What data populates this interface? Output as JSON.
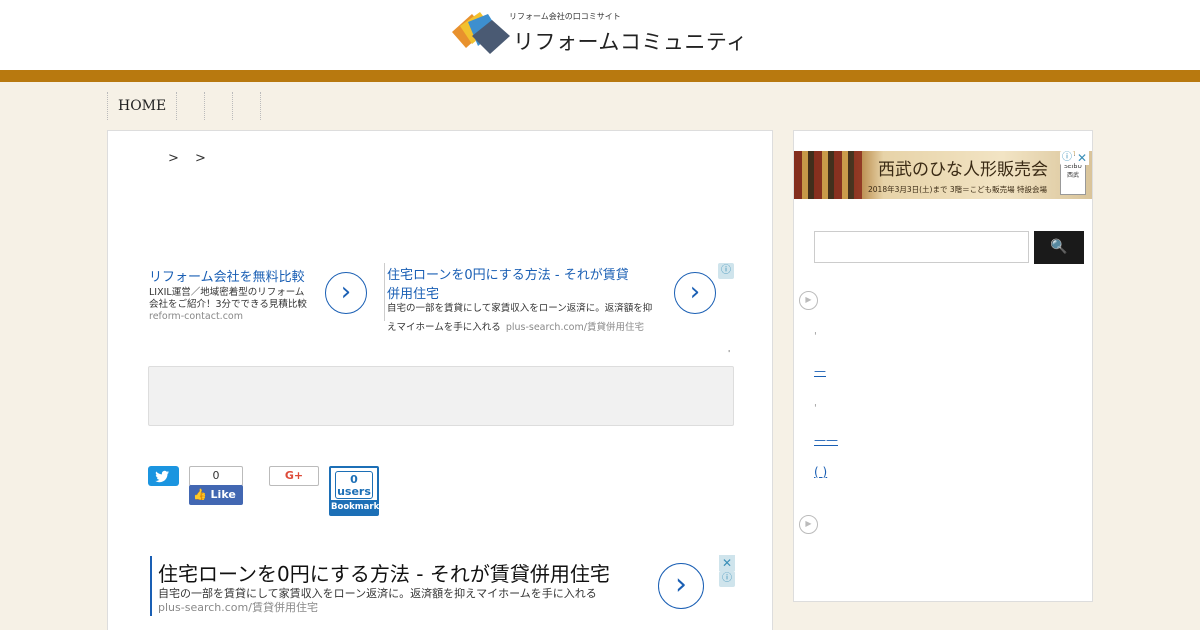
{
  "header": {
    "logo_tagline": "リフォーム会社の口コミサイト",
    "logo_title": "リフォームコミュニティ",
    "logo_colors": [
      "#e8912d",
      "#f2c12e",
      "#3d8fcf",
      "#4a5a73"
    ]
  },
  "colors": {
    "accent_bar": "#b8790f",
    "page_background": "#f6f1e6",
    "ad_link": "#1a5fb4"
  },
  "nav": {
    "items": [
      {
        "label": "HOME"
      },
      {
        "label": ""
      },
      {
        "label": ""
      },
      {
        "label": ""
      }
    ]
  },
  "breadcrumb": {
    "separators": "> >"
  },
  "ad_top": {
    "left": {
      "title": "リフォーム会社を無料比較",
      "desc_line1": "LIXIL運営／地域密着型のリフォーム",
      "desc_line2": "会社をご紹介！3分でできる見積比較",
      "url": "reform-contact.com"
    },
    "right": {
      "title_line1": "住宅ローンを0円にする方法 - それが賃貸",
      "title_line2": "併用住宅",
      "desc_line1": "自宅の一部を賃貸にして家賃収入をローン返済に。返済額を抑",
      "desc_line2": "えマイホームを手に入れる",
      "url": "plus-search.com/賃貸併用住宅"
    },
    "info_icon": "ⓘ"
  },
  "share": {
    "facebook_count": "0",
    "facebook_like": "Like",
    "gplus_label": "G+",
    "hatena_count": "0",
    "hatena_users": "users",
    "hatena_label": "Bookmark"
  },
  "ad_bottom": {
    "title": "住宅ローンを0円にする方法 - それが賃貸併用住宅",
    "desc": "自宅の一部を賃貸にして家賃収入をローン返済に。返済額を抑えマイホームを手に入れる",
    "url": "plus-search.com/賃貸併用住宅",
    "close_icon": "✕",
    "info_icon": "ⓘ"
  },
  "sidebar": {
    "banner": {
      "title": "西武のひな人形販売会",
      "subtitle": "2018年3月3日(土)まで 3階＝こども販売場 特設会場",
      "badge": "SEIBU 西武"
    },
    "search": {
      "placeholder": "",
      "button_icon": "🔍"
    },
    "links": [
      {
        "text": "'"
      },
      {
        "text": "—"
      },
      {
        "text": "'"
      },
      {
        "text": "——"
      },
      {
        "text": "( )"
      }
    ]
  }
}
